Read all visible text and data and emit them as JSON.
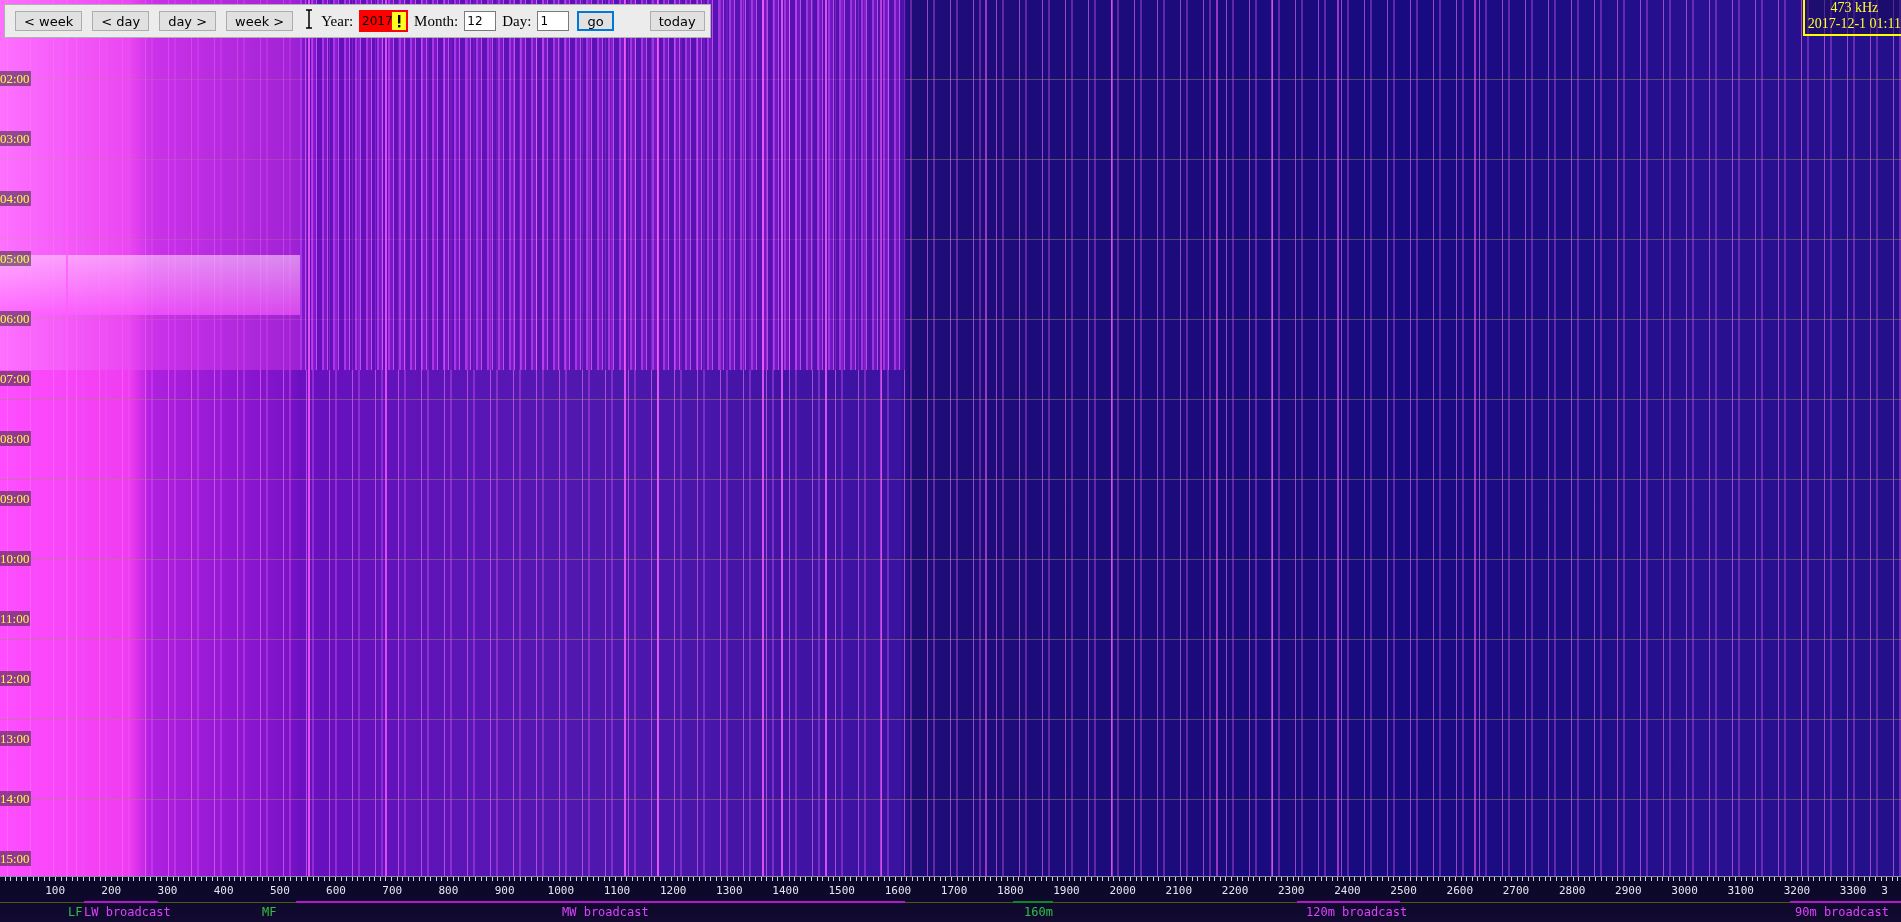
{
  "toolbar": {
    "buttons": [
      {
        "label": "< week"
      },
      {
        "label": "< day"
      },
      {
        "label": "day >"
      },
      {
        "label": "week >"
      }
    ],
    "year": {
      "label": "Year:",
      "value": "2017",
      "invalid": true
    },
    "month": {
      "label": "Month:",
      "value": "12"
    },
    "day": {
      "label": "Day:",
      "value": "1"
    },
    "go": {
      "label": "go",
      "focused": true
    },
    "today": {
      "label": "today"
    }
  },
  "cursor_info": {
    "frequency": "473 kHz",
    "time": "2017-12-1 01:11"
  },
  "time_labels": [
    "02:00",
    "03:00",
    "04:00",
    "05:00",
    "06:00",
    "07:00",
    "08:00",
    "09:00",
    "10:00",
    "11:00",
    "12:00",
    "13:00",
    "14:00",
    "15:00"
  ],
  "freq_axis": [
    "100",
    "200",
    "300",
    "400",
    "500",
    "600",
    "700",
    "800",
    "900",
    "1000",
    "1100",
    "1200",
    "1300",
    "1400",
    "1500",
    "1600",
    "1700",
    "1800",
    "1900",
    "2000",
    "2100",
    "2200",
    "2300",
    "2400",
    "2500",
    "2600",
    "2700",
    "2800",
    "2900",
    "3000",
    "3100",
    "3200",
    "3300",
    "3"
  ],
  "bands": [
    {
      "label": "LF",
      "kind": "amateur"
    },
    {
      "label": "LW broadcast",
      "kind": "broadcast"
    },
    {
      "label": "MF",
      "kind": "amateur"
    },
    {
      "label": "MW broadcast",
      "kind": "broadcast"
    },
    {
      "label": "160m",
      "kind": "amateur"
    },
    {
      "label": "120m broadcast",
      "kind": "broadcast"
    },
    {
      "label": "90m broadcast",
      "kind": "broadcast"
    }
  ]
}
